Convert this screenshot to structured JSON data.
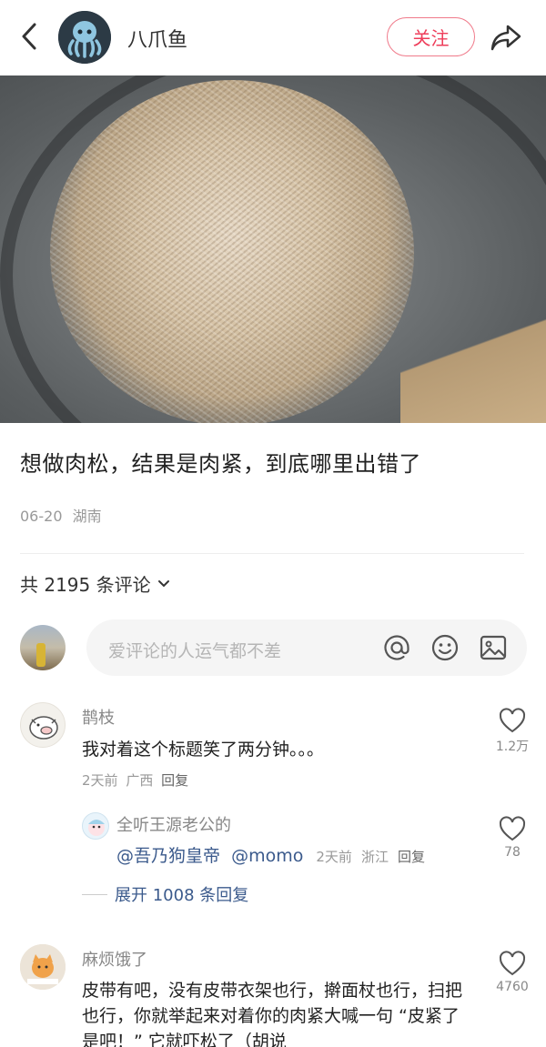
{
  "header": {
    "author_name": "八爪鱼",
    "follow_label": "关注"
  },
  "post": {
    "title": "想做肉松，结果是肉紧，到底哪里出错了",
    "date": "06-20",
    "location": "湖南"
  },
  "comments_section": {
    "count_label": "共 2195 条评论",
    "input_placeholder": "爱评论的人运气都不差"
  },
  "comments": [
    {
      "user": "鹊枝",
      "text": "我对着这个标题笑了两分钟。。。",
      "time": "2天前",
      "location": "广西",
      "reply_label": "回复",
      "likes": "1.2万"
    },
    {
      "user": "麻烦饿了",
      "text": "皮带有吧，没有皮带衣架也行，擀面杖也行，扫把也行，你就举起来对着你的肉紧大喊一句 “皮紧了是吧！” 它就吓松了（胡说",
      "likes": "4760"
    }
  ],
  "reply": {
    "user": "全听王源老公的",
    "mention1": "@吾乃狗皇帝",
    "mention2": "@momo",
    "time": "2天前",
    "location": "浙江",
    "reply_label": "回复",
    "likes": "78"
  },
  "expand_label": "展开 1008 条回复",
  "colors": {
    "accent": "#ee3d5a",
    "link": "#3b5a8c",
    "muted": "#999999"
  }
}
